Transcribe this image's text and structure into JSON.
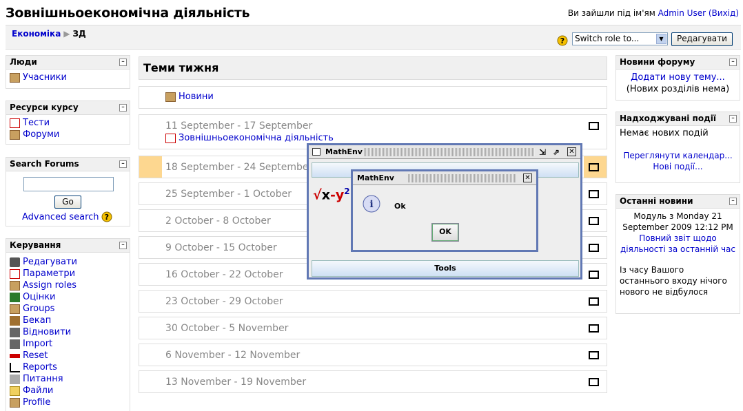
{
  "header": {
    "title": "Зовнішньоекономічна діяльність",
    "login_prefix": "Ви зайшли під ім'ям",
    "user_name": "Admin User",
    "logout": "(Вихід)"
  },
  "nav": {
    "crumb_root": "Економіка",
    "crumb_sep": "▶",
    "crumb_current": "ЗД",
    "switch_role": "Switch role to...",
    "edit_button": "Редагувати"
  },
  "left": {
    "people": {
      "title": "Люди",
      "items": [
        "Учасники"
      ]
    },
    "resources": {
      "title": "Ресурси курсу",
      "items": [
        "Тести",
        "Форуми"
      ]
    },
    "search": {
      "title": "Search Forums",
      "go": "Go",
      "advanced": "Advanced search"
    },
    "admin": {
      "title": "Керування",
      "items": [
        "Редагувати",
        "Параметри",
        "Assign roles",
        "Оцінки",
        "Groups",
        "Бекап",
        "Відновити",
        "Import",
        "Reset",
        "Reports",
        "Питання",
        "Файли",
        "Profile"
      ]
    }
  },
  "main": {
    "heading": "Теми тижня",
    "news": "Новини",
    "weeks": [
      {
        "dates": "11 September - 17 September",
        "activity": "Зовнішньоекономічна діяльність"
      },
      {
        "dates": "18 September - 24 September"
      },
      {
        "dates": "25 September - 1 October"
      },
      {
        "dates": "2 October - 8 October"
      },
      {
        "dates": "9 October - 15 October"
      },
      {
        "dates": "16 October - 22 October"
      },
      {
        "dates": "23 October - 29 October"
      },
      {
        "dates": "30 October - 5 November"
      },
      {
        "dates": "6 November - 12 November"
      },
      {
        "dates": "13 November - 19 November"
      }
    ]
  },
  "right": {
    "forum": {
      "title": "Новини форуму",
      "add": "Додати нову тему...",
      "none": "(Нових розділів нема)"
    },
    "events": {
      "title": "Надходжувані події",
      "none": "Немає нових подій",
      "calendar": "Переглянути календар...",
      "new_event": "Нові події..."
    },
    "latest": {
      "title": "Останні новини",
      "module_line": "Модуль з Monday 21 September 2009 12:12 PM",
      "report_link": "Повний звіт щодо діяльності за останній час",
      "nothing": "Із часу Вашого останнього входу нічого нового не відбулося"
    }
  },
  "mathenv": {
    "title": "MathEnv",
    "formula_x": "x",
    "formula_minus": "-y",
    "formula_exp": "2",
    "tools": "Tools",
    "dialog": {
      "title": "MathEnv",
      "message": "Ok",
      "ok": "OK"
    }
  }
}
